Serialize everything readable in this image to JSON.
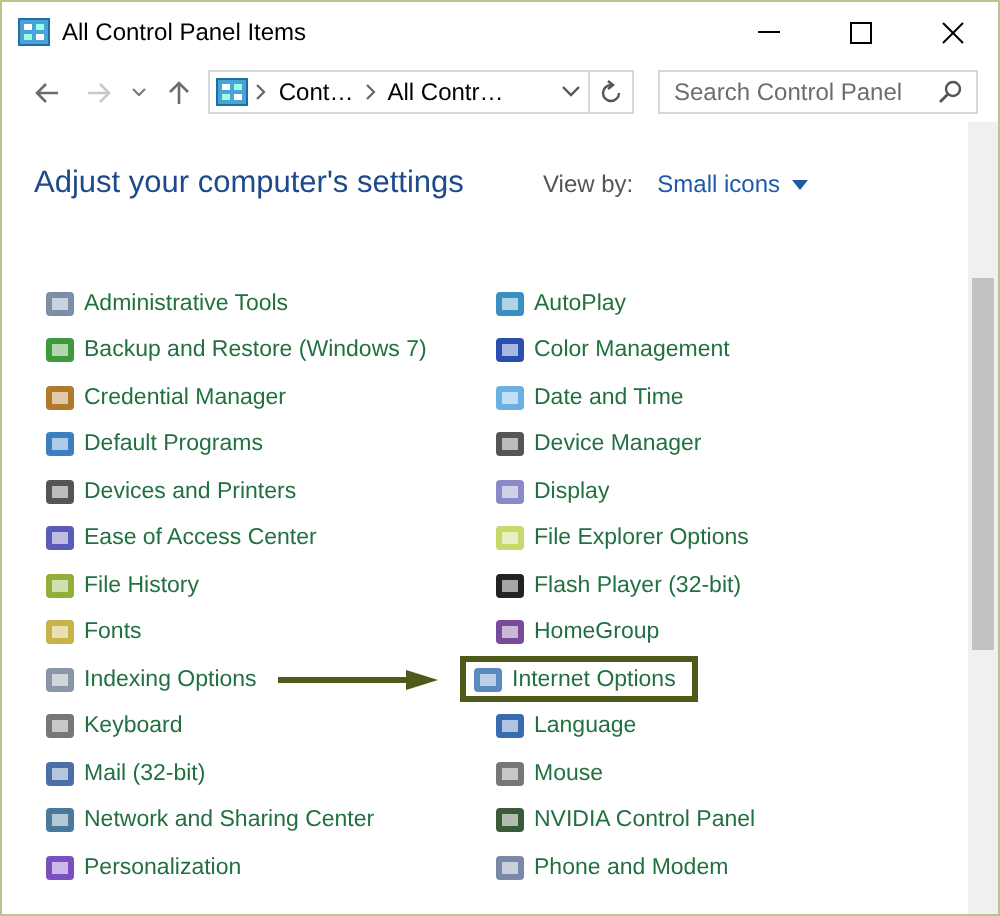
{
  "window": {
    "title": "All Control Panel Items"
  },
  "nav": {
    "back": {
      "disabled": false
    },
    "forward": {
      "disabled": true
    },
    "up": {
      "disabled": false
    },
    "breadcrumbs": [
      "Cont…",
      "All Contr…"
    ],
    "search": {
      "placeholder": "Search Control Panel"
    }
  },
  "header": {
    "title": "Adjust your computer's settings",
    "view_by_label": "View by:",
    "view_by_value": "Small icons"
  },
  "columns": [
    {
      "items": [
        {
          "label": "Administrative Tools",
          "highlighted": false
        },
        {
          "label": "Backup and Restore (Windows 7)",
          "highlighted": false
        },
        {
          "label": "Credential Manager",
          "highlighted": false
        },
        {
          "label": "Default Programs",
          "highlighted": false
        },
        {
          "label": "Devices and Printers",
          "highlighted": false
        },
        {
          "label": "Ease of Access Center",
          "highlighted": false
        },
        {
          "label": "File History",
          "highlighted": false
        },
        {
          "label": "Fonts",
          "highlighted": false
        },
        {
          "label": "Indexing Options",
          "highlighted": false
        },
        {
          "label": "Keyboard",
          "highlighted": false
        },
        {
          "label": "Mail (32-bit)",
          "highlighted": false
        },
        {
          "label": "Network and Sharing Center",
          "highlighted": false
        },
        {
          "label": "Personalization",
          "highlighted": false
        }
      ]
    },
    {
      "items": [
        {
          "label": "AutoPlay",
          "highlighted": false
        },
        {
          "label": "Color Management",
          "highlighted": false
        },
        {
          "label": "Date and Time",
          "highlighted": false
        },
        {
          "label": "Device Manager",
          "highlighted": false
        },
        {
          "label": "Display",
          "highlighted": false
        },
        {
          "label": "File Explorer Options",
          "highlighted": false
        },
        {
          "label": "Flash Player (32-bit)",
          "highlighted": false
        },
        {
          "label": "HomeGroup",
          "highlighted": false
        },
        {
          "label": "Internet Options",
          "highlighted": true
        },
        {
          "label": "Language",
          "highlighted": false
        },
        {
          "label": "Mouse",
          "highlighted": false
        },
        {
          "label": "NVIDIA Control Panel",
          "highlighted": false
        },
        {
          "label": "Phone and Modem",
          "highlighted": false
        }
      ]
    }
  ]
}
